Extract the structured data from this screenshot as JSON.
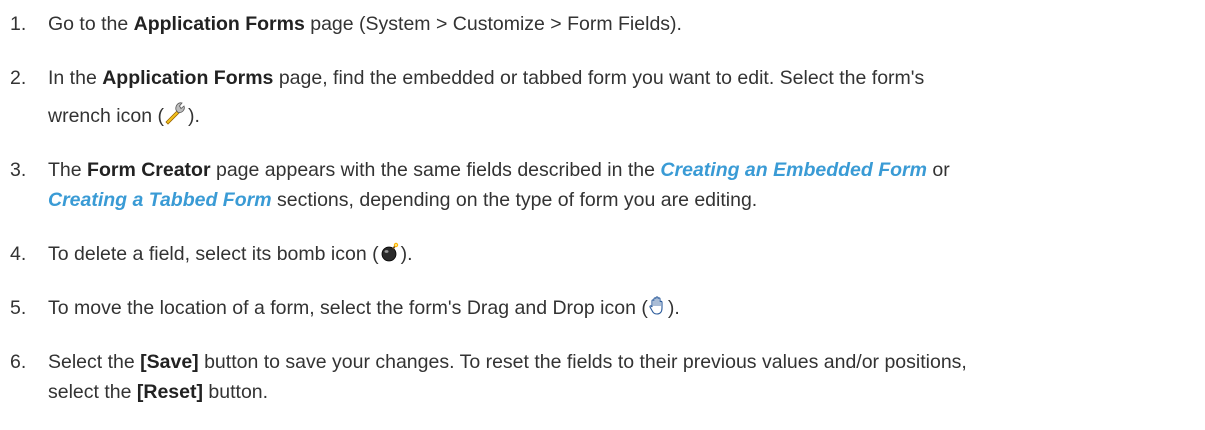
{
  "steps": [
    {
      "num": "1.",
      "pre": "Go to the ",
      "bold": "Application Forms",
      "post": " page (System > Customize > Form Fields)."
    },
    {
      "num": "2.",
      "pre": "In the ",
      "bold": "Application Forms",
      "mid": " page, find the embedded or tabbed form you want to edit. Select the form's",
      "line2_pre": "wrench icon (",
      "line2_post": ").",
      "icon": "wrench-icon"
    },
    {
      "num": "3.",
      "pre": "The ",
      "bold": "Form Creator",
      "mid": " page appears with the same fields described in the ",
      "link1": "Creating an Embedded Form",
      "mid2": " or",
      "link2": "Creating a Tabbed Form",
      "post": " sections, depending on the type of form you are editing."
    },
    {
      "num": "4.",
      "pre": "To delete a field, select its bomb icon (",
      "post": ").",
      "icon": "bomb-icon"
    },
    {
      "num": "5.",
      "pre": "To move the location of a form, select the form's Drag and Drop icon (",
      "post": ").",
      "icon": "hand-icon"
    },
    {
      "num": "6.",
      "pre": "Select the ",
      "bold": "[Save]",
      "mid": " button to save your changes. To reset the fields to their previous values and/or positions,",
      "line2_pre": "select the ",
      "line2_bold": "[Reset]",
      "line2_post": " button."
    }
  ],
  "colors": {
    "text": "#333333",
    "link": "#3a9bd5"
  }
}
